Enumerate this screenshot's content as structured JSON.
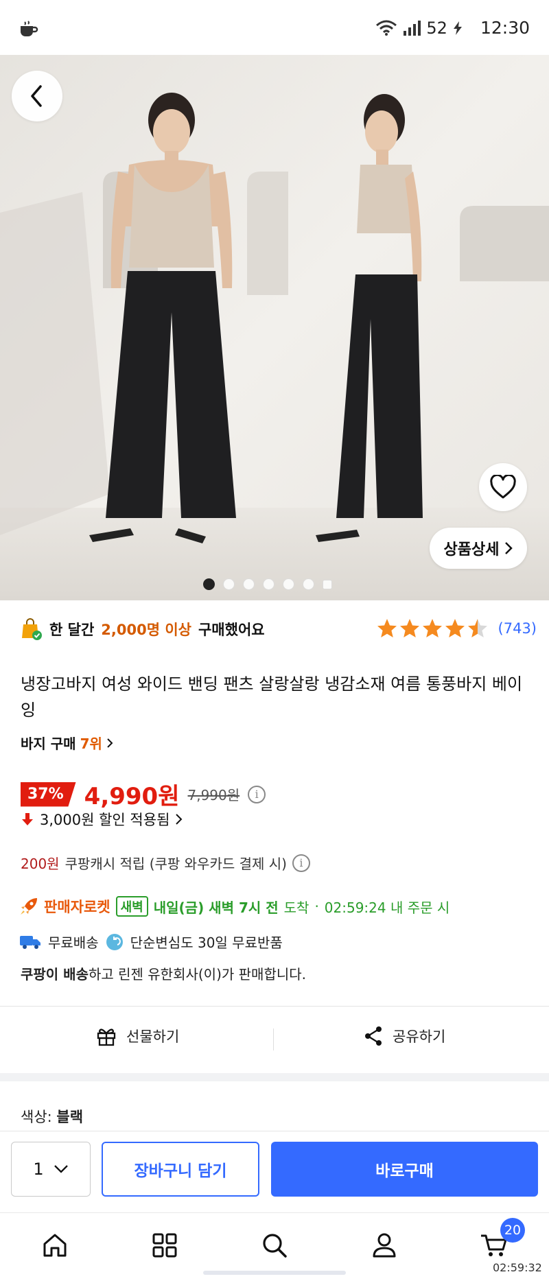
{
  "status_bar": {
    "battery": "52",
    "time": "12:30"
  },
  "product": {
    "purchase_note_prefix": "한 달간",
    "purchase_note_count": "2,000명 이상",
    "purchase_note_suffix": "구매했어요",
    "rating": 4.5,
    "review_count": "(743)",
    "title": "냉장고바지 여성 와이드 밴딩 팬츠 살랑살랑 냉감소재 여름 통풍바지 베이잉",
    "rank_label": "바지 구매",
    "rank_value": "7위",
    "discount_badge": "37%",
    "price": "4,990원",
    "original_price": "7,990원",
    "discount_text": "3,000원 할인 적용됨",
    "cash_amount": "200원",
    "cash_text": "쿠팡캐시 적립 (쿠팡 와우카드 결제 시)",
    "rocket_brand": "판매자로켓",
    "rocket_tag": "새벽",
    "delivery_day": "내일(금) 새벽 7시 전",
    "delivery_word": "도착",
    "delivery_deadline": "02:59:24 내 주문 시",
    "free_shipping": "무료배송",
    "free_return": "단순변심도 30일 무료반품",
    "seller_bold": "쿠팡이 배송",
    "seller_text": "하고 린젠 유한회사(이)가 판매합니다.",
    "color_label": "색상:",
    "color_value": "블랙"
  },
  "image": {
    "slide_count": 6,
    "active_slide": 1,
    "detail_label": "상품상세"
  },
  "actions": {
    "gift_label": "선물하기",
    "share_label": "공유하기"
  },
  "buy_bar": {
    "quantity": "1",
    "cart_label": "장바구니 담기",
    "buy_label": "바로구매"
  },
  "nav": {
    "cart_badge": "20",
    "clock": "02:59:32"
  },
  "colors": {
    "accent": "#346aff",
    "price_red": "#e11d0f",
    "delivery_green": "#2a9d2a",
    "rocket_orange": "#e8590c"
  }
}
